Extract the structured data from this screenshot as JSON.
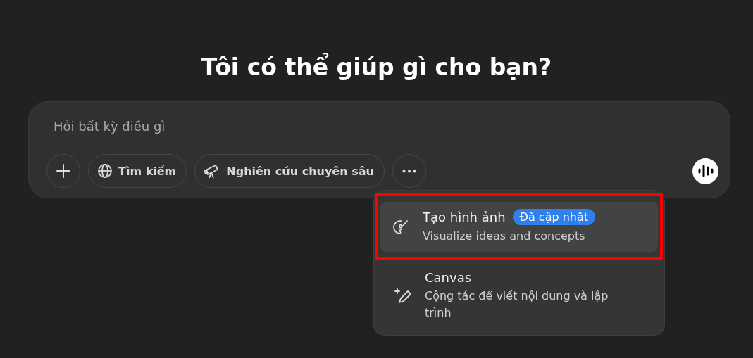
{
  "heading": "Tôi có thể giúp gì cho bạn?",
  "composer": {
    "placeholder": "Hỏi bất kỳ điều gì",
    "tools": [
      {
        "kind": "add"
      },
      {
        "kind": "search",
        "label": "Tìm kiếm"
      },
      {
        "kind": "research",
        "label": "Nghiên cứu chuyên sâu"
      },
      {
        "kind": "more"
      }
    ]
  },
  "menu": {
    "items": [
      {
        "kind": "image",
        "title": "Tạo hình ảnh",
        "badge": "Đã cập nhật",
        "description": "Visualize ideas and concepts",
        "selected": true,
        "highlighted": true
      },
      {
        "kind": "canvas",
        "title": "Canvas",
        "description": "Cộng tác để viết nội dung và lập trình",
        "selected": false,
        "highlighted": false
      }
    ]
  }
}
